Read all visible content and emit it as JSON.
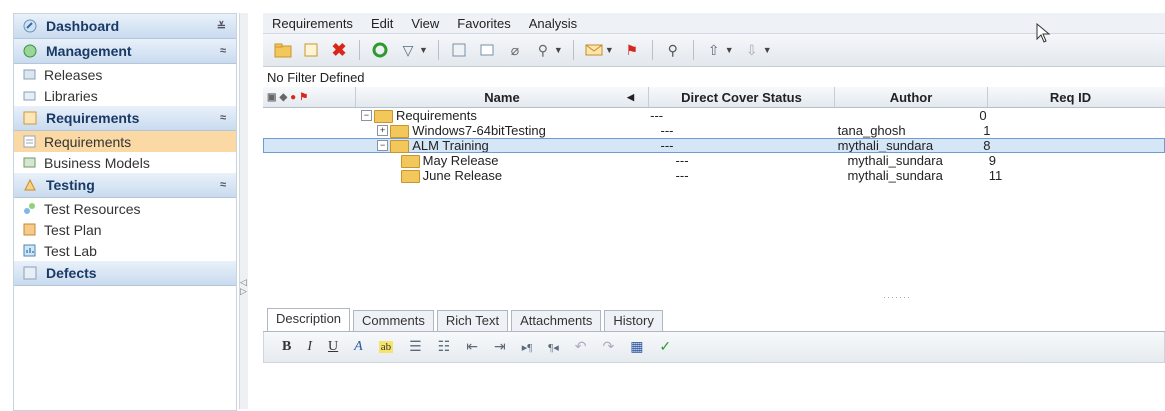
{
  "sidebar": {
    "groups": [
      {
        "label": "Dashboard",
        "chevron": "≚"
      },
      {
        "label": "Management",
        "chevron": "≈"
      },
      {
        "label": "Requirements",
        "chevron": "≈"
      },
      {
        "label": "Testing",
        "chevron": "≈"
      },
      {
        "label": "Defects",
        "chevron": ""
      }
    ],
    "items": [
      {
        "label": "Releases",
        "icon": "releases-icon"
      },
      {
        "label": "Libraries",
        "icon": "libraries-icon"
      },
      {
        "label": "Requirements",
        "icon": "requirements-icon"
      },
      {
        "label": "Business Models",
        "icon": "business-models-icon"
      },
      {
        "label": "Test Resources",
        "icon": "test-resources-icon"
      },
      {
        "label": "Test Plan",
        "icon": "test-plan-icon"
      },
      {
        "label": "Test Lab",
        "icon": "test-lab-icon"
      }
    ]
  },
  "menubar": [
    "Requirements",
    "Edit",
    "View",
    "Favorites",
    "Analysis"
  ],
  "filter": "No Filter Defined",
  "grid": {
    "columns": [
      "Name",
      "Direct Cover Status",
      "Author",
      "Req ID"
    ],
    "rows": [
      {
        "name": "Requirements",
        "cover": "---",
        "author": "",
        "reqid": "0"
      },
      {
        "name": "Windows7-64bitTesting",
        "cover": "---",
        "author": "tana_ghosh",
        "reqid": "1"
      },
      {
        "name": "ALM Training",
        "cover": "---",
        "author": "mythali_sundara",
        "reqid": "8"
      },
      {
        "name": "May Release",
        "cover": "---",
        "author": "mythali_sundara",
        "reqid": "9"
      },
      {
        "name": "June Release",
        "cover": "---",
        "author": "mythali_sundara",
        "reqid": "11"
      }
    ]
  },
  "details": {
    "tabs": [
      "Description",
      "Comments",
      "Rich Text",
      "Attachments",
      "History"
    ]
  },
  "colors": {
    "sidebar_active": "#fbd9a5",
    "selection": "#d5e6f7",
    "header_text": "#1a3a66"
  }
}
